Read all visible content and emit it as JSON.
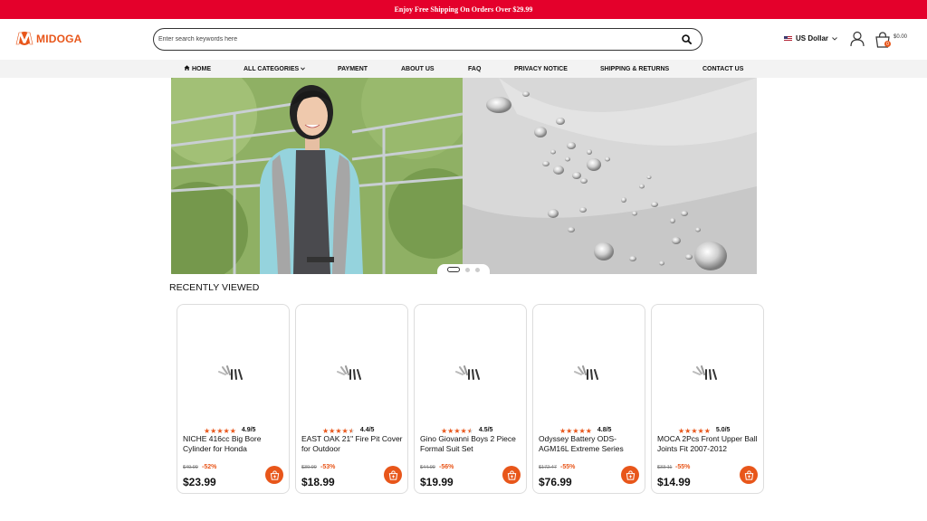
{
  "topbar": {
    "text": "Enjoy Free Shipping On Orders Over $29.99"
  },
  "header": {
    "logo_text": "MIDOGA",
    "search_placeholder": "Enter search keywords here",
    "currency": "US Dollar",
    "cart_count": "0",
    "cart_total": "$0.00"
  },
  "nav": {
    "items": [
      {
        "label": "HOME"
      },
      {
        "label": "ALL CATEGORIES"
      },
      {
        "label": "PAYMENT"
      },
      {
        "label": "ABOUT US"
      },
      {
        "label": "FAQ"
      },
      {
        "label": "PRIVACY NOTICE"
      },
      {
        "label": "SHIPPING & RETURNS"
      },
      {
        "label": "CONTACT US"
      }
    ]
  },
  "carousel": {
    "slide_count": 3,
    "active_index": 0
  },
  "recently_viewed": {
    "title": "RECENTLY VIEWED",
    "products": [
      {
        "rating": 4.9,
        "rating_text": "4.9/5",
        "name": "NICHE 416cc Big Bore Cylinder for Honda",
        "old_price": "$49.99",
        "discount": "-52%",
        "price": "$23.99"
      },
      {
        "rating": 4.4,
        "rating_text": "4.4/5",
        "name": "EAST OAK 21\" Fire Pit Cover for Outdoor",
        "old_price": "$39.99",
        "discount": "-53%",
        "price": "$18.99"
      },
      {
        "rating": 4.5,
        "rating_text": "4.5/5",
        "name": "Gino Giovanni Boys 2 Piece Formal Suit Set",
        "old_price": "$44.99",
        "discount": "-56%",
        "price": "$19.99"
      },
      {
        "rating": 4.8,
        "rating_text": "4.8/5",
        "name": "Odyssey Battery ODS-AGM16L Extreme Series",
        "old_price": "$172.47",
        "discount": "-55%",
        "price": "$76.99"
      },
      {
        "rating": 5.0,
        "rating_text": "5.0/5",
        "name": "MOCA 2Pcs Front Upper Ball Joints Fit 2007-2012",
        "old_price": "$33.11",
        "discount": "-55%",
        "price": "$14.99"
      }
    ]
  },
  "colors": {
    "brand": "#e8561a",
    "topbar_bg": "#e4002b",
    "nav_bg": "#f3f3f3"
  }
}
